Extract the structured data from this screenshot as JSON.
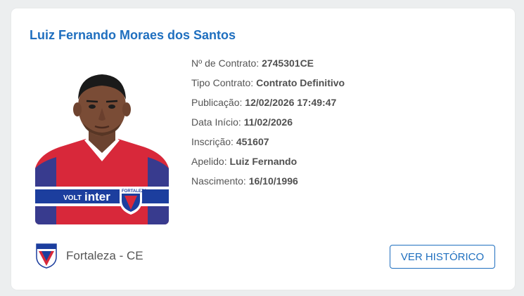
{
  "player": {
    "name": "Luiz Fernando Moraes dos Santos"
  },
  "details": [
    {
      "label": "Nº de Contrato: ",
      "value": "2745301CE"
    },
    {
      "label": "Tipo Contrato: ",
      "value": "Contrato Definitivo"
    },
    {
      "label": "Publicação: ",
      "value": "12/02/2026 17:49:47"
    },
    {
      "label": "Data Início: ",
      "value": "11/02/2026"
    },
    {
      "label": "Inscrição: ",
      "value": "451607"
    },
    {
      "label": "Apelido: ",
      "value": "Luiz Fernando"
    },
    {
      "label": "Nascimento: ",
      "value": "16/10/1996"
    }
  ],
  "club": {
    "name": "Fortaleza - CE",
    "crest_icon": "fortaleza-crest-icon"
  },
  "jersey": {
    "sponsor_prefix": "VOLT",
    "sponsor": "inter",
    "badge_text": "FORTALEZA"
  },
  "actions": {
    "history_label": "VER HISTÓRICO"
  },
  "colors": {
    "accent": "#1f6fbf",
    "jersey_red": "#d8283a",
    "jersey_blue": "#1c3e9e"
  }
}
